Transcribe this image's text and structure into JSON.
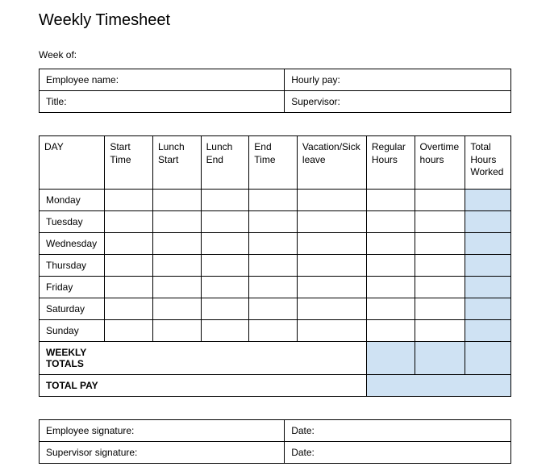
{
  "title": "Weekly Timesheet",
  "week_of_label": "Week of:",
  "info": {
    "employee_name_label": "Employee name:",
    "hourly_pay_label": "Hourly pay:",
    "title_label": "Title:",
    "supervisor_label": "Supervisor:"
  },
  "headers": {
    "day": "DAY",
    "start_time": "Start Time",
    "lunch_start": "Lunch Start",
    "lunch_end": "Lunch End",
    "end_time": "End Time",
    "vacation_sick": "Vacation/Sick leave",
    "regular_hours": "Regular Hours",
    "overtime_hours": "Overtime hours",
    "total_hours": "Total Hours Worked"
  },
  "days": {
    "mon": "Monday",
    "tue": "Tuesday",
    "wed": "Wednesday",
    "thu": "Thursday",
    "fri": "Friday",
    "sat": "Saturday",
    "sun": "Sunday"
  },
  "totals": {
    "weekly_totals_label": "WEEKLY TOTALS",
    "total_pay_label": "TOTAL PAY"
  },
  "signatures": {
    "employee_label": "Employee signature:",
    "supervisor_label": "Supervisor signature:",
    "date_label": "Date:"
  }
}
